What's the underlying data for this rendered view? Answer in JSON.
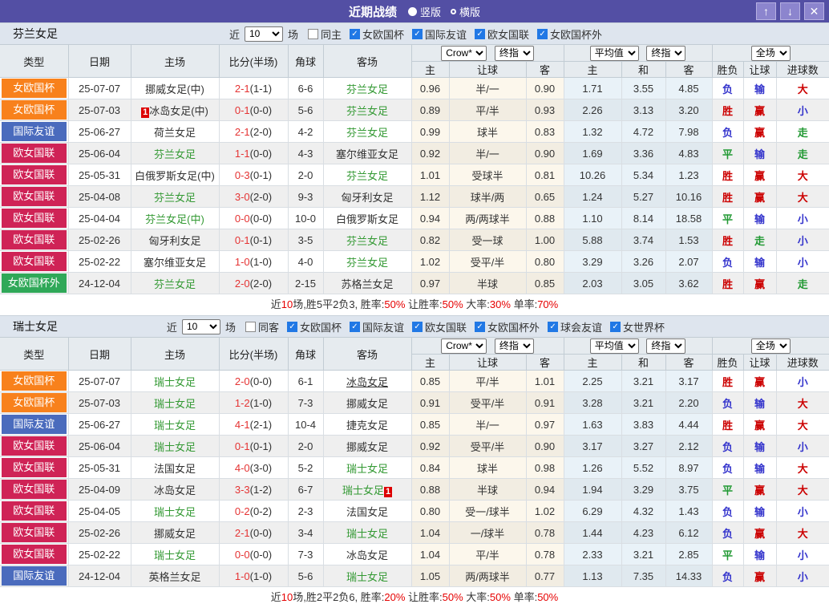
{
  "titlebar": {
    "title": "近期战绩",
    "radios": [
      {
        "label": "竖版",
        "selected": true
      },
      {
        "label": "横版",
        "selected": false
      }
    ],
    "buttons": {
      "up": "↑",
      "down": "↓",
      "close": "✕"
    }
  },
  "labels": {
    "near": "近",
    "games": "场",
    "cols": [
      "类型",
      "日期",
      "主场",
      "比分(半场)",
      "角球",
      "客场"
    ],
    "subcols": [
      "主",
      "让球",
      "客",
      "主",
      "和",
      "客",
      "胜负",
      "让球",
      "进球数"
    ],
    "selects": {
      "crow": "Crow*",
      "final": "终指",
      "avg": "平均值",
      "full": "全场"
    }
  },
  "colors": {
    "titlebar": "#534fa4",
    "team_highlight": "#339933",
    "score_red": "#e53333",
    "result_red": "#cc0000",
    "result_green": "#229933",
    "result_blue": "#3333cc",
    "checkbox_accent": "#2178e5",
    "type_badges": {
      "女欧国杯": "#f8811c",
      "国际友谊": "#4a6bbd",
      "欧女国联": "#cf2356",
      "女欧国杯外": "#2fa858"
    }
  },
  "sections": [
    {
      "team": "芬兰女足",
      "near_value": "10",
      "same_label": "同主",
      "same_checked": false,
      "filters": [
        {
          "label": "女欧国杯",
          "checked": true
        },
        {
          "label": "国际友谊",
          "checked": true
        },
        {
          "label": "欧女国联",
          "checked": true
        },
        {
          "label": "女欧国杯外",
          "checked": true
        }
      ],
      "rows": [
        {
          "type": "女欧国杯",
          "date": "25-07-07",
          "home": "挪威女足(中)",
          "score": "2-1",
          "half": "(1-1)",
          "corner": "6-6",
          "away": "芬兰女足",
          "away_green": true,
          "o1": "0.96",
          "hcp": "半/一",
          "o2": "0.90",
          "a1": "1.71",
          "a2": "3.55",
          "a3": "4.85",
          "r1": [
            "负",
            "b"
          ],
          "r2": [
            "输",
            "b"
          ],
          "r3": [
            "大",
            "r"
          ]
        },
        {
          "type": "女欧国杯",
          "date": "25-07-03",
          "home": "冰岛女足(中)",
          "home_badge_before": "1",
          "score": "0-1",
          "half": "(0-0)",
          "corner": "5-6",
          "away": "芬兰女足",
          "away_green": true,
          "o1": "0.89",
          "hcp": "平/半",
          "o2": "0.93",
          "a1": "2.26",
          "a2": "3.13",
          "a3": "3.20",
          "r1": [
            "胜",
            "r"
          ],
          "r2": [
            "赢",
            "r"
          ],
          "r3": [
            "小",
            "b"
          ]
        },
        {
          "type": "国际友谊",
          "date": "25-06-27",
          "home": "荷兰女足",
          "score": "2-1",
          "half": "(2-0)",
          "corner": "4-2",
          "away": "芬兰女足",
          "away_green": true,
          "o1": "0.99",
          "hcp": "球半",
          "o2": "0.83",
          "a1": "1.32",
          "a2": "4.72",
          "a3": "7.98",
          "r1": [
            "负",
            "b"
          ],
          "r2": [
            "赢",
            "r"
          ],
          "r3": [
            "走",
            "g"
          ]
        },
        {
          "type": "欧女国联",
          "date": "25-06-04",
          "home": "芬兰女足",
          "home_green": true,
          "score": "1-1",
          "half": "(0-0)",
          "corner": "4-3",
          "away": "塞尔维亚女足",
          "o1": "0.92",
          "hcp": "半/一",
          "o2": "0.90",
          "a1": "1.69",
          "a2": "3.36",
          "a3": "4.83",
          "r1": [
            "平",
            "g"
          ],
          "r2": [
            "输",
            "b"
          ],
          "r3": [
            "走",
            "g"
          ]
        },
        {
          "type": "欧女国联",
          "date": "25-05-31",
          "home": "白俄罗斯女足(中)",
          "score": "0-3",
          "half": "(0-1)",
          "corner": "2-0",
          "away": "芬兰女足",
          "away_green": true,
          "o1": "1.01",
          "hcp": "受球半",
          "o2": "0.81",
          "a1": "10.26",
          "a2": "5.34",
          "a3": "1.23",
          "r1": [
            "胜",
            "r"
          ],
          "r2": [
            "赢",
            "r"
          ],
          "r3": [
            "大",
            "r"
          ]
        },
        {
          "type": "欧女国联",
          "date": "25-04-08",
          "home": "芬兰女足",
          "home_green": true,
          "score": "3-0",
          "half": "(2-0)",
          "corner": "9-3",
          "away": "匈牙利女足",
          "o1": "1.12",
          "hcp": "球半/两",
          "o2": "0.65",
          "a1": "1.24",
          "a2": "5.27",
          "a3": "10.16",
          "r1": [
            "胜",
            "r"
          ],
          "r2": [
            "赢",
            "r"
          ],
          "r3": [
            "大",
            "r"
          ]
        },
        {
          "type": "欧女国联",
          "date": "25-04-04",
          "home": "芬兰女足(中)",
          "home_green": true,
          "score": "0-0",
          "half": "(0-0)",
          "corner": "10-0",
          "away": "白俄罗斯女足",
          "o1": "0.94",
          "hcp": "两/两球半",
          "o2": "0.88",
          "a1": "1.10",
          "a2": "8.14",
          "a3": "18.58",
          "r1": [
            "平",
            "g"
          ],
          "r2": [
            "输",
            "b"
          ],
          "r3": [
            "小",
            "b"
          ]
        },
        {
          "type": "欧女国联",
          "date": "25-02-26",
          "home": "匈牙利女足",
          "score": "0-1",
          "half": "(0-1)",
          "corner": "3-5",
          "away": "芬兰女足",
          "away_green": true,
          "o1": "0.82",
          "hcp": "受一球",
          "o2": "1.00",
          "a1": "5.88",
          "a2": "3.74",
          "a3": "1.53",
          "r1": [
            "胜",
            "r"
          ],
          "r2": [
            "走",
            "g"
          ],
          "r3": [
            "小",
            "b"
          ]
        },
        {
          "type": "欧女国联",
          "date": "25-02-22",
          "home": "塞尔维亚女足",
          "score": "1-0",
          "half": "(1-0)",
          "corner": "4-0",
          "away": "芬兰女足",
          "away_green": true,
          "o1": "1.02",
          "hcp": "受平/半",
          "o2": "0.80",
          "a1": "3.29",
          "a2": "3.26",
          "a3": "2.07",
          "r1": [
            "负",
            "b"
          ],
          "r2": [
            "输",
            "b"
          ],
          "r3": [
            "小",
            "b"
          ]
        },
        {
          "type": "女欧国杯外",
          "date": "24-12-04",
          "home": "芬兰女足",
          "home_green": true,
          "score": "2-0",
          "half": "(2-0)",
          "corner": "2-15",
          "away": "苏格兰女足",
          "o1": "0.97",
          "hcp": "半球",
          "o2": "0.85",
          "a1": "2.03",
          "a2": "3.05",
          "a3": "3.62",
          "r1": [
            "胜",
            "r"
          ],
          "r2": [
            "赢",
            "r"
          ],
          "r3": [
            "走",
            "g"
          ]
        }
      ],
      "summary": [
        {
          "t": "近"
        },
        {
          "t": "10",
          "r": 1
        },
        {
          "t": "场,胜5平2负3, 胜率:"
        },
        {
          "t": "50%",
          "r": 1
        },
        {
          "t": " 让胜率:"
        },
        {
          "t": "50%",
          "r": 1
        },
        {
          "t": " 大率:"
        },
        {
          "t": "30%",
          "r": 1
        },
        {
          "t": " 单率:"
        },
        {
          "t": "70%",
          "r": 1
        }
      ]
    },
    {
      "team": "瑞士女足",
      "near_value": "10",
      "same_label": "同客",
      "same_checked": false,
      "filters": [
        {
          "label": "女欧国杯",
          "checked": true
        },
        {
          "label": "国际友谊",
          "checked": true
        },
        {
          "label": "欧女国联",
          "checked": true
        },
        {
          "label": "女欧国杯外",
          "checked": true
        },
        {
          "label": "球会友谊",
          "checked": true
        },
        {
          "label": "女世界杯",
          "checked": true
        }
      ],
      "rows": [
        {
          "type": "女欧国杯",
          "date": "25-07-07",
          "home": "瑞士女足",
          "home_green": true,
          "score": "2-0",
          "half": "(0-0)",
          "corner": "6-1",
          "away": "冰岛女足",
          "away_underline": true,
          "o1": "0.85",
          "hcp": "平/半",
          "o2": "1.01",
          "a1": "2.25",
          "a2": "3.21",
          "a3": "3.17",
          "r1": [
            "胜",
            "r"
          ],
          "r2": [
            "赢",
            "r"
          ],
          "r3": [
            "小",
            "b"
          ]
        },
        {
          "type": "女欧国杯",
          "date": "25-07-03",
          "home": "瑞士女足",
          "home_green": true,
          "score": "1-2",
          "half": "(1-0)",
          "corner": "7-3",
          "away": "挪威女足",
          "o1": "0.91",
          "hcp": "受平/半",
          "o2": "0.91",
          "a1": "3.28",
          "a2": "3.21",
          "a3": "2.20",
          "r1": [
            "负",
            "b"
          ],
          "r2": [
            "输",
            "b"
          ],
          "r3": [
            "大",
            "r"
          ]
        },
        {
          "type": "国际友谊",
          "date": "25-06-27",
          "home": "瑞士女足",
          "home_green": true,
          "score": "4-1",
          "half": "(2-1)",
          "corner": "10-4",
          "away": "捷克女足",
          "o1": "0.85",
          "hcp": "半/一",
          "o2": "0.97",
          "a1": "1.63",
          "a2": "3.83",
          "a3": "4.44",
          "r1": [
            "胜",
            "r"
          ],
          "r2": [
            "赢",
            "r"
          ],
          "r3": [
            "大",
            "r"
          ]
        },
        {
          "type": "欧女国联",
          "date": "25-06-04",
          "home": "瑞士女足",
          "home_green": true,
          "score": "0-1",
          "half": "(0-1)",
          "corner": "2-0",
          "away": "挪威女足",
          "o1": "0.92",
          "hcp": "受平/半",
          "o2": "0.90",
          "a1": "3.17",
          "a2": "3.27",
          "a3": "2.12",
          "r1": [
            "负",
            "b"
          ],
          "r2": [
            "输",
            "b"
          ],
          "r3": [
            "小",
            "b"
          ]
        },
        {
          "type": "欧女国联",
          "date": "25-05-31",
          "home": "法国女足",
          "score": "4-0",
          "half": "(3-0)",
          "corner": "5-2",
          "away": "瑞士女足",
          "away_green": true,
          "o1": "0.84",
          "hcp": "球半",
          "o2": "0.98",
          "a1": "1.26",
          "a2": "5.52",
          "a3": "8.97",
          "r1": [
            "负",
            "b"
          ],
          "r2": [
            "输",
            "b"
          ],
          "r3": [
            "大",
            "r"
          ]
        },
        {
          "type": "欧女国联",
          "date": "25-04-09",
          "home": "冰岛女足",
          "score": "3-3",
          "half": "(1-2)",
          "corner": "6-7",
          "away": "瑞士女足",
          "away_green": true,
          "away_badge_after": "1",
          "o1": "0.88",
          "hcp": "半球",
          "o2": "0.94",
          "a1": "1.94",
          "a2": "3.29",
          "a3": "3.75",
          "r1": [
            "平",
            "g"
          ],
          "r2": [
            "赢",
            "r"
          ],
          "r3": [
            "大",
            "r"
          ]
        },
        {
          "type": "欧女国联",
          "date": "25-04-05",
          "home": "瑞士女足",
          "home_green": true,
          "score": "0-2",
          "half": "(0-2)",
          "corner": "2-3",
          "away": "法国女足",
          "o1": "0.80",
          "hcp": "受一/球半",
          "o2": "1.02",
          "a1": "6.29",
          "a2": "4.32",
          "a3": "1.43",
          "r1": [
            "负",
            "b"
          ],
          "r2": [
            "输",
            "b"
          ],
          "r3": [
            "小",
            "b"
          ]
        },
        {
          "type": "欧女国联",
          "date": "25-02-26",
          "home": "挪威女足",
          "score": "2-1",
          "half": "(0-0)",
          "corner": "3-4",
          "away": "瑞士女足",
          "away_green": true,
          "o1": "1.04",
          "hcp": "一/球半",
          "o2": "0.78",
          "a1": "1.44",
          "a2": "4.23",
          "a3": "6.12",
          "r1": [
            "负",
            "b"
          ],
          "r2": [
            "赢",
            "r"
          ],
          "r3": [
            "大",
            "r"
          ]
        },
        {
          "type": "欧女国联",
          "date": "25-02-22",
          "home": "瑞士女足",
          "home_green": true,
          "score": "0-0",
          "half": "(0-0)",
          "corner": "7-3",
          "away": "冰岛女足",
          "o1": "1.04",
          "hcp": "平/半",
          "o2": "0.78",
          "a1": "2.33",
          "a2": "3.21",
          "a3": "2.85",
          "r1": [
            "平",
            "g"
          ],
          "r2": [
            "输",
            "b"
          ],
          "r3": [
            "小",
            "b"
          ]
        },
        {
          "type": "国际友谊",
          "date": "24-12-04",
          "home": "英格兰女足",
          "score": "1-0",
          "half": "(1-0)",
          "corner": "5-6",
          "away": "瑞士女足",
          "away_green": true,
          "o1": "1.05",
          "hcp": "两/两球半",
          "o2": "0.77",
          "a1": "1.13",
          "a2": "7.35",
          "a3": "14.33",
          "r1": [
            "负",
            "b"
          ],
          "r2": [
            "赢",
            "r"
          ],
          "r3": [
            "小",
            "b"
          ]
        }
      ],
      "summary": [
        {
          "t": "近"
        },
        {
          "t": "10",
          "r": 1
        },
        {
          "t": "场,胜2平2负6, 胜率:"
        },
        {
          "t": "20%",
          "r": 1
        },
        {
          "t": " 让胜率:"
        },
        {
          "t": "50%",
          "r": 1
        },
        {
          "t": " 大率:"
        },
        {
          "t": "50%",
          "r": 1
        },
        {
          "t": " 单率:"
        },
        {
          "t": "50%",
          "r": 1
        }
      ]
    }
  ]
}
